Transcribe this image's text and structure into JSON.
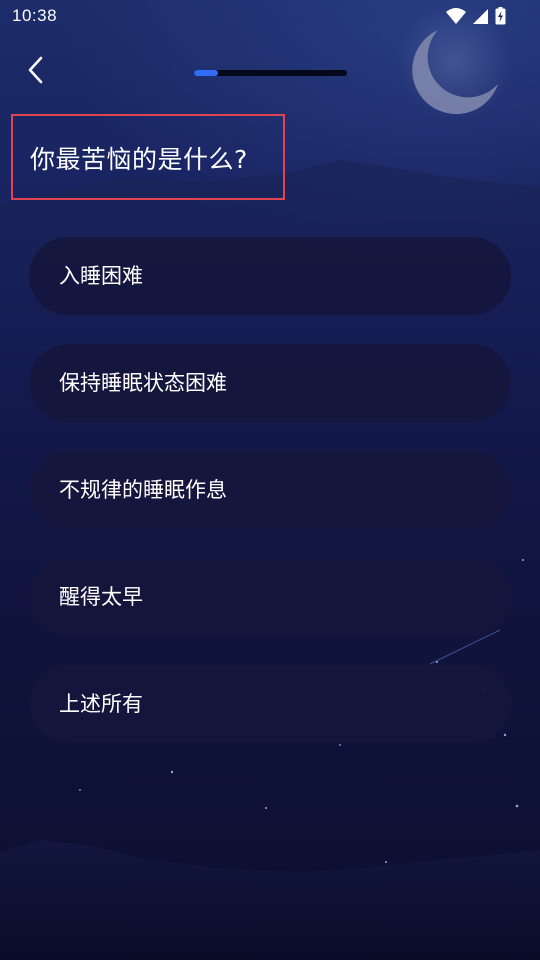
{
  "status_bar": {
    "time": "10:38",
    "icons": [
      "wifi-icon",
      "cellular-signal-icon",
      "battery-charging-icon"
    ]
  },
  "navigation": {
    "back_icon": "chevron-left-icon",
    "progress": 0.16
  },
  "question": {
    "title": "你最苦恼的是什么?"
  },
  "options": [
    {
      "label": "入睡困难"
    },
    {
      "label": "保持睡眠状态困难"
    },
    {
      "label": "不规律的睡眠作息"
    },
    {
      "label": "醒得太早"
    },
    {
      "label": "上述所有"
    }
  ],
  "colors": {
    "progress_fill": "#2f6df6",
    "progress_track": "#05081a",
    "highlight_border": "#e0444f",
    "option_background": "#16163c"
  }
}
